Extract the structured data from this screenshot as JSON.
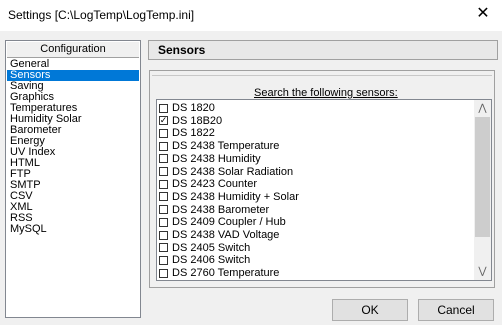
{
  "window": {
    "title": "Settings [C:\\LogTemp\\LogTemp.ini]",
    "close_glyph": "✕"
  },
  "sidebar": {
    "header": "Configuration",
    "selected": "Sensors",
    "items": [
      {
        "label": "General"
      },
      {
        "label": "Sensors"
      },
      {
        "label": "Saving"
      },
      {
        "label": "Graphics"
      },
      {
        "label": "Temperatures"
      },
      {
        "label": "Humidity  Solar"
      },
      {
        "label": "Barometer"
      },
      {
        "label": "Energy"
      },
      {
        "label": "UV Index"
      },
      {
        "label": "HTML"
      },
      {
        "label": "FTP"
      },
      {
        "label": "SMTP"
      },
      {
        "label": "CSV"
      },
      {
        "label": "XML"
      },
      {
        "label": "RSS"
      },
      {
        "label": "MySQL"
      }
    ]
  },
  "panel": {
    "title": "Sensors",
    "search_label": "Search the following sensors:"
  },
  "sensors": [
    {
      "label": "DS 1820",
      "checked": false
    },
    {
      "label": "DS 18B20",
      "checked": true
    },
    {
      "label": "DS 1822",
      "checked": false
    },
    {
      "label": "DS 2438 Temperature",
      "checked": false
    },
    {
      "label": "DS 2438 Humidity",
      "checked": false
    },
    {
      "label": "DS 2438 Solar Radiation",
      "checked": false
    },
    {
      "label": "DS 2423 Counter",
      "checked": false
    },
    {
      "label": "DS 2438 Humidity + Solar",
      "checked": false
    },
    {
      "label": "DS 2438 Barometer",
      "checked": false
    },
    {
      "label": "DS 2409 Coupler / Hub",
      "checked": false
    },
    {
      "label": "DS 2438 VAD Voltage",
      "checked": false
    },
    {
      "label": "DS 2405 Switch",
      "checked": false
    },
    {
      "label": "DS 2406 Switch",
      "checked": false
    },
    {
      "label": "DS 2760 Temperature",
      "checked": false
    }
  ],
  "buttons": {
    "ok": "OK",
    "cancel": "Cancel"
  },
  "colors": {
    "selection": "#0078d7",
    "window_bg": "#f0f0f0"
  }
}
